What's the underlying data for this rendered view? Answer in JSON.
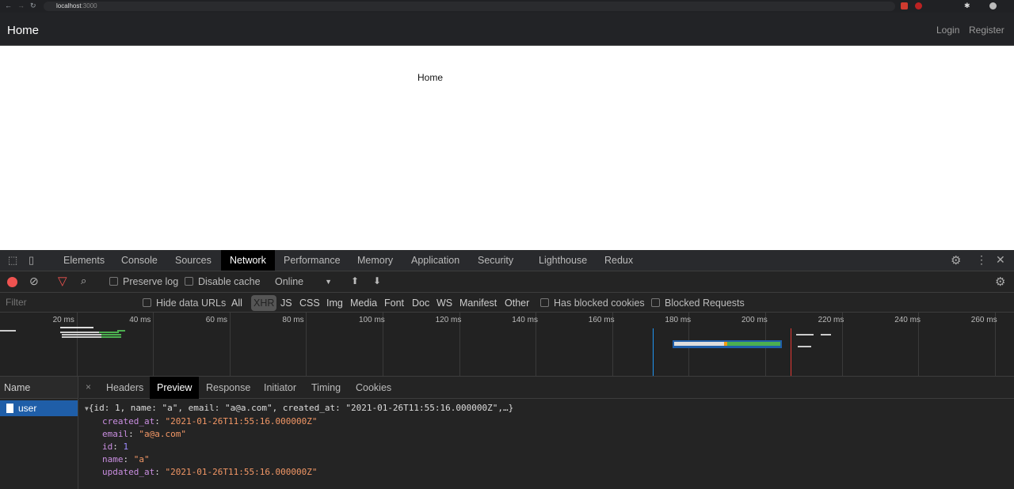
{
  "browser": {
    "url_host": "localhost",
    "url_port": ":3000"
  },
  "navbar": {
    "brand": "Home",
    "links": [
      "Login",
      "Register"
    ]
  },
  "page": {
    "content": "Home"
  },
  "devtools": {
    "tabs": [
      "Elements",
      "Console",
      "Sources",
      "Network",
      "Performance",
      "Memory",
      "Application",
      "Security",
      "Lighthouse",
      "Redux"
    ],
    "active_tab": "Network",
    "toolbar": {
      "preserve_log": "Preserve log",
      "disable_cache": "Disable cache",
      "throttling": "Online"
    },
    "filter": {
      "placeholder": "Filter",
      "hide_data_urls": "Hide data URLs",
      "types": [
        "All",
        "XHR",
        "JS",
        "CSS",
        "Img",
        "Media",
        "Font",
        "Doc",
        "WS",
        "Manifest",
        "Other"
      ],
      "active_type": "XHR",
      "has_blocked_cookies": "Has blocked cookies",
      "blocked_requests": "Blocked Requests"
    },
    "timeline": {
      "ticks": [
        "20 ms",
        "40 ms",
        "60 ms",
        "80 ms",
        "100 ms",
        "120 ms",
        "140 ms",
        "160 ms",
        "180 ms",
        "200 ms",
        "220 ms",
        "240 ms",
        "260 ms"
      ]
    },
    "requests": {
      "header": "Name",
      "items": [
        "user"
      ]
    },
    "detail_tabs": [
      "Headers",
      "Preview",
      "Response",
      "Initiator",
      "Timing",
      "Cookies"
    ],
    "active_detail_tab": "Preview",
    "preview": {
      "summary": "{id: 1, name: \"a\", email: \"a@a.com\", created_at: \"2021-01-26T11:55:16.000000Z\",…}",
      "fields": [
        {
          "key": "created_at",
          "value": "\"2021-01-26T11:55:16.000000Z\"",
          "type": "string"
        },
        {
          "key": "email",
          "value": "\"a@a.com\"",
          "type": "string"
        },
        {
          "key": "id",
          "value": "1",
          "type": "number"
        },
        {
          "key": "name",
          "value": "\"a\"",
          "type": "string"
        },
        {
          "key": "updated_at",
          "value": "\"2021-01-26T11:55:16.000000Z\"",
          "type": "string"
        }
      ]
    }
  }
}
